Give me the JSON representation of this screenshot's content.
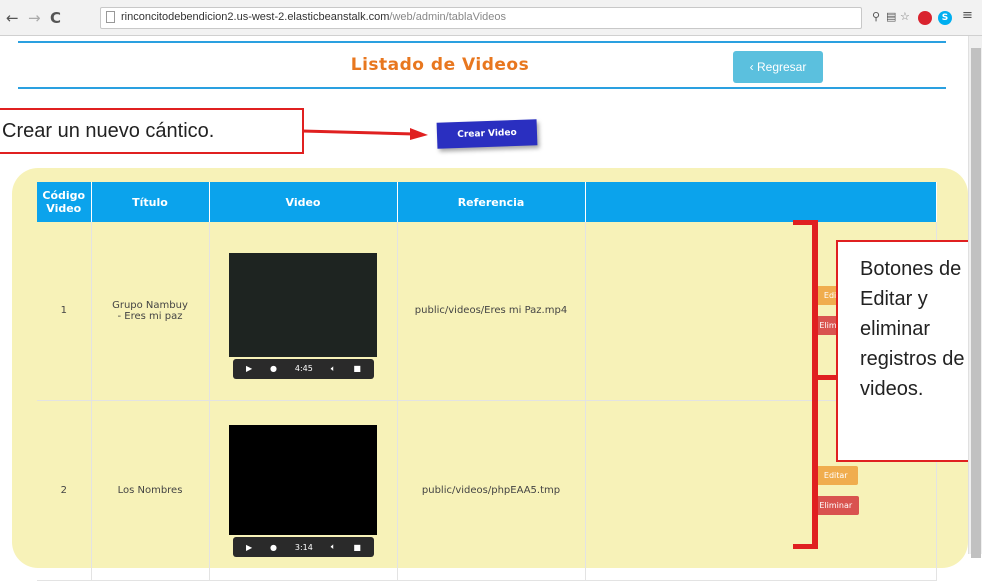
{
  "browser": {
    "back_glyph": "←",
    "forward_glyph": "→",
    "reload_glyph": "C",
    "url_host": "rinconcitodebendicion2.us-west-2.elasticbeanstalk.com",
    "url_path": "/web/admin/tablaVideos",
    "extensions": [
      "zoom-icon",
      "translate-icon",
      "star-icon",
      "adblock-icon",
      "skype-icon",
      "menu-icon"
    ]
  },
  "header": {
    "title": "Listado de Videos",
    "back_button": "‹ Regresar",
    "create_button": "Crear Video"
  },
  "annotations": {
    "create_callout": "Crear un nuevo cántico.",
    "buttons_callout": "Botones de\nEditar y\neliminar\nregistros de\nvideos.",
    "color": "#e02020"
  },
  "table": {
    "headers": [
      "Código Video",
      "Título",
      "Video",
      "Referencia",
      ""
    ],
    "rows": [
      {
        "codigo": "1",
        "titulo": "Grupo Nambuy - Eres mi paz",
        "video_time": "4:45",
        "referencia": "public/videos/Eres mi Paz.mp4",
        "edit": "Editar",
        "delete": "Eliminar"
      },
      {
        "codigo": "2",
        "titulo": "Los Nombres",
        "video_time": "3:14",
        "referencia": "public/videos/phpEAA5.tmp",
        "edit": "Editar",
        "delete": "Eliminar"
      }
    ]
  },
  "colors": {
    "accent": "#0ba3ec",
    "title_orange": "#e8771f",
    "panel_yellow": "#f7f2b8",
    "edit_orange": "#f0ad4e",
    "delete_red": "#d9534f",
    "info_blue": "#5bc0de",
    "create_blue": "#2a2fc0"
  }
}
